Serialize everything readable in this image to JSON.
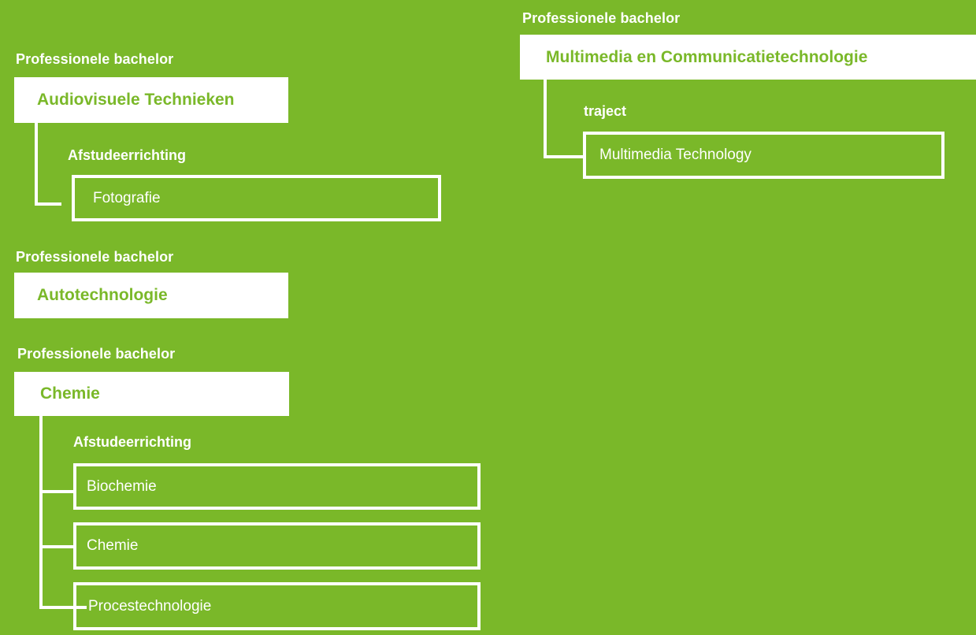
{
  "blocks": [
    {
      "category": "Professionele bachelor",
      "program": "Audiovisuele Technieken",
      "sublabel": "Afstudeerrichting",
      "options": [
        "Fotografie"
      ]
    },
    {
      "category": "Professionele bachelor",
      "program": "Autotechnologie"
    },
    {
      "category": "Professionele bachelor",
      "program": "Chemie",
      "sublabel": "Afstudeerrichting",
      "options": [
        "Biochemie",
        "Chemie",
        "Procestechnologie"
      ]
    },
    {
      "category": "Professionele bachelor",
      "program": "Multimedia en Communicatietechnologie",
      "sublabel": "traject",
      "options": [
        "Multimedia Technology"
      ]
    }
  ]
}
